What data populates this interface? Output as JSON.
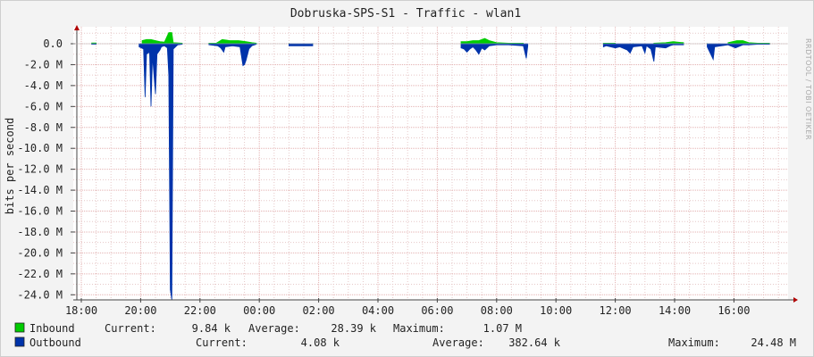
{
  "chart_data": {
    "type": "area",
    "title": "Dobruska-SPS-S1 - Traffic - wlan1",
    "ylabel": "bits per second",
    "watermark": "RRDTOOL / TOBI OETIKER",
    "x_ticks": [
      "18:00",
      "20:00",
      "22:00",
      "00:00",
      "02:00",
      "04:00",
      "06:00",
      "08:00",
      "10:00",
      "12:00",
      "14:00",
      "16:00"
    ],
    "y_ticks": [
      "0.0",
      "-2.0 M",
      "-4.0 M",
      "-6.0 M",
      "-8.0 M",
      "-10.0 M",
      "-12.0 M",
      "-14.0 M",
      "-16.0 M",
      "-18.0 M",
      "-20.0 M",
      "-22.0 M",
      "-24.0 M"
    ],
    "y_tick_values": [
      0,
      -2,
      -4,
      -6,
      -8,
      -10,
      -12,
      -14,
      -16,
      -18,
      -20,
      -22,
      -24
    ],
    "ylim": [
      -24.5,
      1.2
    ],
    "xlim_hours": [
      17.8,
      41.7
    ],
    "grid": true,
    "colors": {
      "inbound": "#00cc00",
      "outbound": "#0033aa",
      "grid": "#e6c8c8",
      "axis": "#444444"
    },
    "series": [
      {
        "name": "Inbound",
        "color": "#00cc00",
        "unit": "M bits/s",
        "points": [
          [
            18.35,
            0.08
          ],
          [
            18.5,
            0.08
          ],
          [
            20.05,
            0.3
          ],
          [
            20.2,
            0.4
          ],
          [
            20.35,
            0.4
          ],
          [
            20.5,
            0.3
          ],
          [
            20.65,
            0.2
          ],
          [
            20.8,
            0.15
          ],
          [
            20.95,
            1.07
          ],
          [
            21.05,
            1.07
          ],
          [
            21.1,
            0.1
          ],
          [
            21.4,
            0.05
          ],
          [
            22.3,
            0.05
          ],
          [
            22.55,
            0.05
          ],
          [
            22.75,
            0.4
          ],
          [
            23.0,
            0.3
          ],
          [
            23.3,
            0.3
          ],
          [
            23.55,
            0.2
          ],
          [
            23.75,
            0.1
          ],
          [
            23.9,
            0.05
          ],
          [
            25.0,
            0.05
          ],
          [
            25.8,
            0.05
          ],
          [
            30.8,
            0.2
          ],
          [
            31.0,
            0.2
          ],
          [
            31.2,
            0.3
          ],
          [
            31.4,
            0.3
          ],
          [
            31.6,
            0.5
          ],
          [
            31.75,
            0.3
          ],
          [
            32.0,
            0.1
          ],
          [
            32.4,
            0.05
          ],
          [
            32.9,
            0.05
          ],
          [
            35.6,
            0.05
          ],
          [
            36.0,
            0.05
          ],
          [
            36.6,
            0.05
          ],
          [
            37.3,
            0.05
          ],
          [
            37.7,
            0.1
          ],
          [
            37.95,
            0.2
          ],
          [
            38.3,
            0.1
          ],
          [
            39.1,
            0.05
          ],
          [
            39.8,
            0.1
          ],
          [
            40.1,
            0.3
          ],
          [
            40.3,
            0.3
          ],
          [
            40.5,
            0.1
          ],
          [
            40.8,
            0.05
          ],
          [
            41.2,
            0.05
          ]
        ]
      },
      {
        "name": "Outbound",
        "color": "#0033aa",
        "unit": "M bits/s",
        "points": [
          [
            18.35,
            -0.05
          ],
          [
            18.5,
            -0.05
          ],
          [
            19.95,
            -0.3
          ],
          [
            20.1,
            -0.5
          ],
          [
            20.15,
            -5.1
          ],
          [
            20.2,
            -1.0
          ],
          [
            20.3,
            -0.8
          ],
          [
            20.35,
            -6.0
          ],
          [
            20.4,
            -1.2
          ],
          [
            20.5,
            -4.8
          ],
          [
            20.55,
            -1.0
          ],
          [
            20.65,
            -0.6
          ],
          [
            20.7,
            -0.3
          ],
          [
            20.8,
            -0.2
          ],
          [
            20.9,
            -0.4
          ],
          [
            20.95,
            -3.0
          ],
          [
            21.0,
            -23.5
          ],
          [
            21.05,
            -24.48
          ],
          [
            21.1,
            -0.5
          ],
          [
            21.25,
            -0.1
          ],
          [
            21.4,
            -0.05
          ],
          [
            22.3,
            -0.1
          ],
          [
            22.6,
            -0.2
          ],
          [
            22.7,
            -0.4
          ],
          [
            22.8,
            -0.8
          ],
          [
            22.85,
            -0.3
          ],
          [
            23.1,
            -0.2
          ],
          [
            23.35,
            -0.3
          ],
          [
            23.45,
            -2.1
          ],
          [
            23.5,
            -2.0
          ],
          [
            23.55,
            -1.6
          ],
          [
            23.65,
            -0.5
          ],
          [
            23.75,
            -0.2
          ],
          [
            23.9,
            -0.05
          ],
          [
            25.0,
            -0.2
          ],
          [
            25.4,
            -0.2
          ],
          [
            25.8,
            -0.2
          ],
          [
            30.8,
            -0.4
          ],
          [
            30.9,
            -0.5
          ],
          [
            31.0,
            -0.8
          ],
          [
            31.1,
            -0.5
          ],
          [
            31.2,
            -0.3
          ],
          [
            31.3,
            -0.6
          ],
          [
            31.4,
            -1.0
          ],
          [
            31.5,
            -0.4
          ],
          [
            31.6,
            -0.6
          ],
          [
            31.75,
            -0.2
          ],
          [
            32.0,
            -0.1
          ],
          [
            32.4,
            -0.1
          ],
          [
            32.9,
            -0.2
          ],
          [
            33.0,
            -1.4
          ],
          [
            33.05,
            -0.2
          ],
          [
            35.6,
            -0.3
          ],
          [
            35.7,
            -0.2
          ],
          [
            36.0,
            -0.4
          ],
          [
            36.15,
            -0.3
          ],
          [
            36.4,
            -0.6
          ],
          [
            36.5,
            -0.9
          ],
          [
            36.6,
            -0.3
          ],
          [
            36.9,
            -0.2
          ],
          [
            37.0,
            -0.9
          ],
          [
            37.05,
            -0.2
          ],
          [
            37.2,
            -0.5
          ],
          [
            37.3,
            -1.7
          ],
          [
            37.35,
            -0.3
          ],
          [
            37.7,
            -0.4
          ],
          [
            37.85,
            -0.2
          ],
          [
            37.95,
            -0.1
          ],
          [
            38.3,
            -0.1
          ],
          [
            39.1,
            -0.3
          ],
          [
            39.3,
            -1.5
          ],
          [
            39.35,
            -0.3
          ],
          [
            39.8,
            -0.1
          ],
          [
            40.05,
            -0.4
          ],
          [
            40.3,
            -0.1
          ],
          [
            40.5,
            -0.1
          ],
          [
            40.8,
            -0.05
          ],
          [
            41.2,
            -0.05
          ]
        ]
      }
    ],
    "legend": {
      "inbound": {
        "label": "Inbound",
        "current_label": "Current:",
        "current": "9.84 k",
        "average_label": "Average:",
        "average": "28.39 k",
        "maximum_label": "Maximum:",
        "maximum": "1.07 M"
      },
      "outbound": {
        "label": "Outbound",
        "current_label": "Current:",
        "current": "4.08 k",
        "average_label": "Average:",
        "average": "382.64 k",
        "maximum_label": "Maximum:",
        "maximum": "24.48 M"
      }
    }
  }
}
